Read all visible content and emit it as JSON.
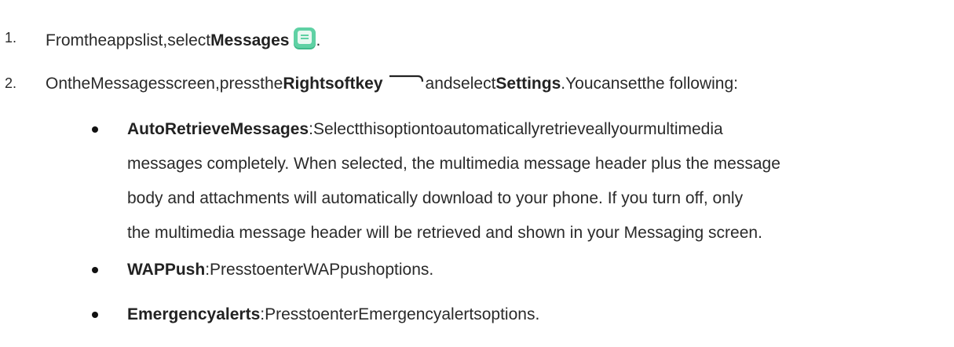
{
  "steps": [
    {
      "number": "1.",
      "prefix": "Fromtheappslist,select",
      "bold": "Messages",
      "suffix": "."
    },
    {
      "number": "2.",
      "prefix": "OntheMessagesscreen,pressthe",
      "bold": "Rightsoftkey",
      "middle": "andselect",
      "bold2": "Settings",
      "suffix": ".Youcansetthe following:"
    }
  ],
  "options": [
    {
      "title": "AutoRetrieveMessages",
      "separator": ":",
      "lines": [
        "Selectthisoptiontoautomaticallyretrieveallyourmultimedia",
        "messages completely. When selected, the multimedia message header plus the message",
        "body and attachments will automatically download to your phone. If you turn off, only",
        "the multimedia message header will be retrieved and shown in your Messaging screen."
      ]
    },
    {
      "title": "WAPPush",
      "separator": ":",
      "lines": [
        "PresstoenterWAPpushoptions."
      ]
    },
    {
      "title": "Emergencyalerts",
      "separator": ":",
      "lines": [
        "PresstoenterEmergencyalertsoptions."
      ]
    }
  ],
  "icons": {
    "messages_app": "messages-app-icon",
    "softkey": "right-softkey-icon"
  },
  "colors": {
    "icon_green": "#5fd1a4",
    "icon_green_dark": "#3fb98a",
    "text": "#2a2a2a"
  }
}
